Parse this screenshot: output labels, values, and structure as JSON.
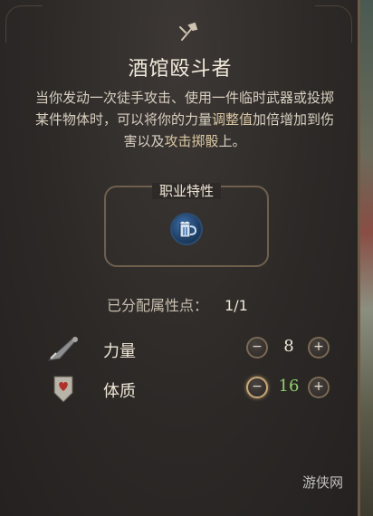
{
  "feat": {
    "icon": "hammer-axe-icon",
    "title": "酒馆殴斗者",
    "description_parts": [
      "当你发动一次徒手攻击、使用一件临时武器或投掷某件物体时，可以将你的力量",
      "调整值",
      "加倍增加到伤害以及",
      "攻击掷骰",
      "上。"
    ]
  },
  "trait": {
    "label": "职业特性",
    "icon": "beer-mug-icon"
  },
  "points": {
    "label": "已分配属性点：",
    "value": "1/1"
  },
  "abilities": [
    {
      "name": "力量",
      "value": "8",
      "icon": "sword-arm-icon",
      "boosted": false
    },
    {
      "name": "体质",
      "value": "16",
      "icon": "heart-banner-icon",
      "boosted": true
    }
  ],
  "watermark": "游侠网",
  "colors": {
    "boosted_value": "#8fcf6a",
    "accent_border": "#c9a977"
  }
}
